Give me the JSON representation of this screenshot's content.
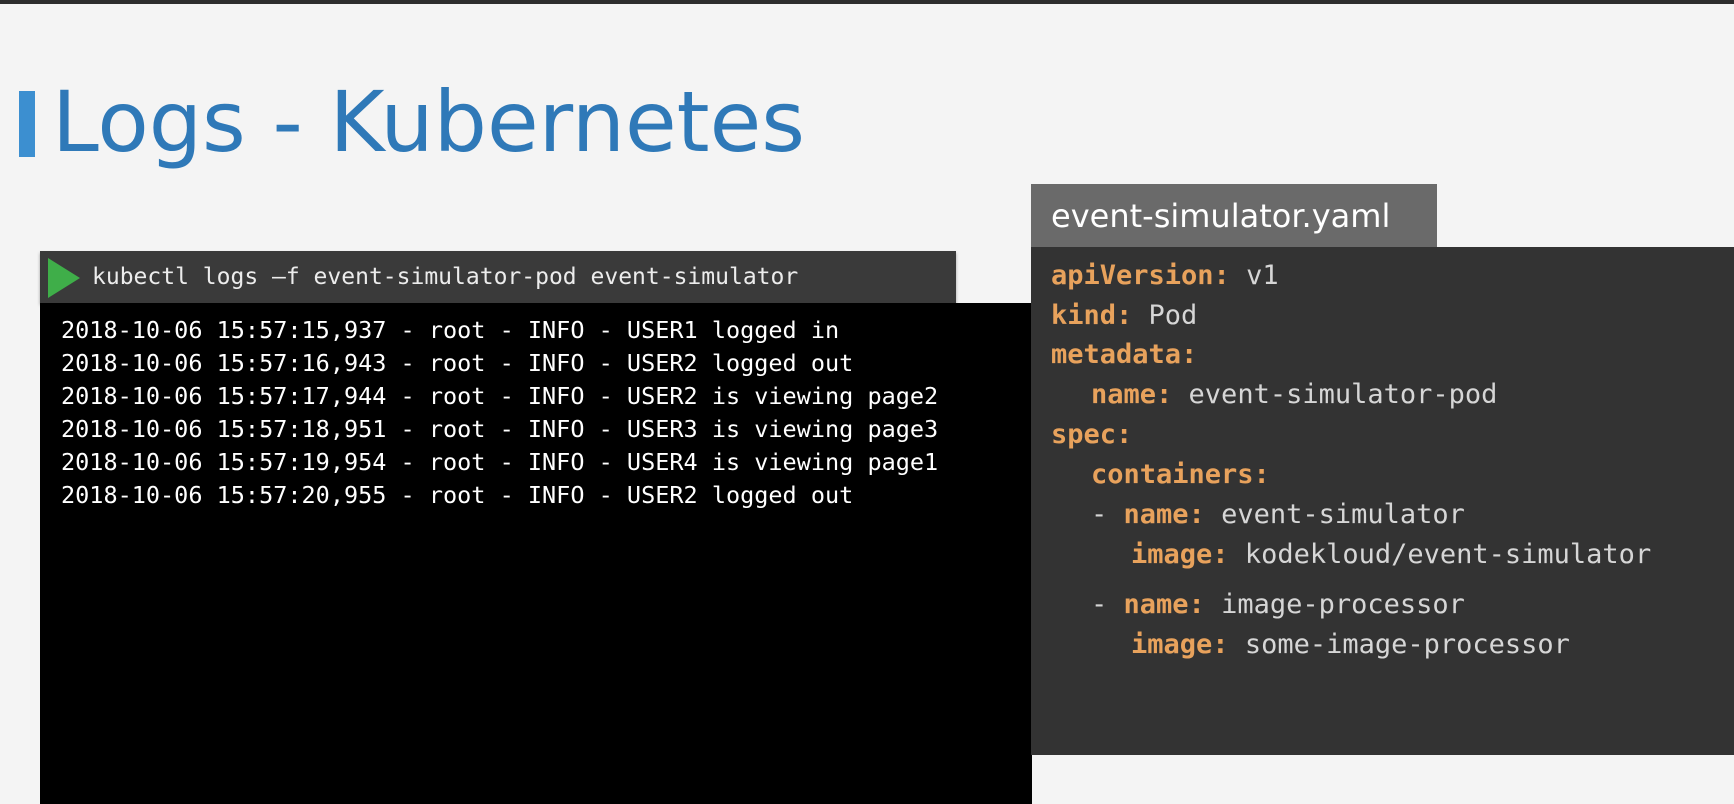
{
  "slide": {
    "title": "Logs - Kubernetes"
  },
  "terminal": {
    "command": "kubectl logs –f event-simulator-pod event-simulator",
    "lines": [
      "2018-10-06 15:57:15,937 - root - INFO - USER1 logged in",
      "2018-10-06 15:57:16,943 - root - INFO - USER2 logged out",
      "2018-10-06 15:57:17,944 - root - INFO - USER2 is viewing page2",
      "2018-10-06 15:57:18,951 - root - INFO - USER3 is viewing page3",
      "2018-10-06 15:57:19,954 - root - INFO - USER4 is viewing page1",
      "2018-10-06 15:57:20,955 - root - INFO - USER2 logged out"
    ]
  },
  "yaml": {
    "filename": "event-simulator.yaml",
    "apiVersion": {
      "key": "apiVersion:",
      "value": "v1"
    },
    "kind": {
      "key": "kind:",
      "value": "Pod"
    },
    "metadata": {
      "key": "metadata:"
    },
    "metadata_name": {
      "key": "name:",
      "value": "event-simulator-pod"
    },
    "spec": {
      "key": "spec:"
    },
    "containers": {
      "key": "containers:"
    },
    "dash": "-",
    "container1_name": {
      "key": "name:",
      "value": "event-simulator"
    },
    "container1_image": {
      "key": "image:",
      "value": "kodekloud/event-simulator"
    },
    "container2_name": {
      "key": "name:",
      "value": "image-processor"
    },
    "container2_image": {
      "key": "image:",
      "value": "some-image-processor"
    }
  },
  "colors": {
    "title": "#2f79b8",
    "title_accent": "#3c8fd0",
    "yaml_key": "#e8a25c",
    "play_icon": "#3fae49"
  },
  "icons": {
    "terminal_prompt": "play-icon"
  }
}
